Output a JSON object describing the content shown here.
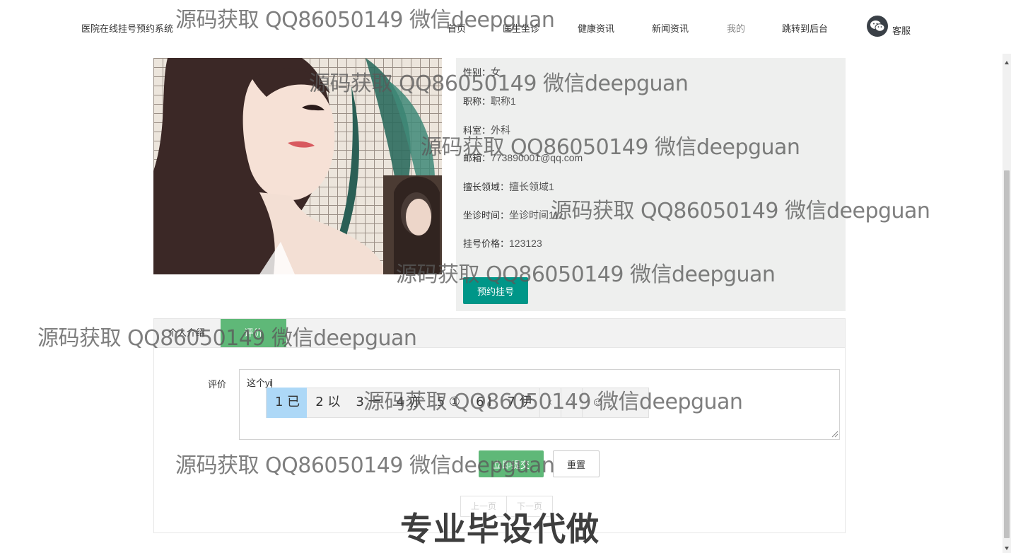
{
  "header": {
    "brand": "医院在线挂号预约系统",
    "nav": [
      {
        "label": "首页",
        "name": "nav-home"
      },
      {
        "label": "医生坐诊",
        "name": "nav-doctor-clinic"
      },
      {
        "label": "健康资讯",
        "name": "nav-health-news"
      },
      {
        "label": "新闻资讯",
        "name": "nav-news"
      },
      {
        "label": "我的",
        "name": "nav-mine"
      },
      {
        "label": "跳转到后台",
        "name": "nav-admin"
      }
    ],
    "service_label": "客服",
    "service_icon": "wechat-icon"
  },
  "doctor": {
    "fields": [
      {
        "label": "性别：",
        "value": "女"
      },
      {
        "label": "职称：",
        "value": "职称1"
      },
      {
        "label": "科室：",
        "value": "外科"
      },
      {
        "label": "邮箱：",
        "value": "773890001@qq.com"
      },
      {
        "label": "擅长领域：",
        "value": "擅长领域1"
      },
      {
        "label": "坐诊时间：",
        "value": "坐诊时间111"
      },
      {
        "label": "挂号价格：",
        "value": "123123"
      }
    ],
    "book_button": "预约挂号"
  },
  "tabs": [
    {
      "label": "个人介绍",
      "active": false
    },
    {
      "label": "评价",
      "active": true
    }
  ],
  "review_form": {
    "label": "评价",
    "value": "这个yi",
    "submit_label": "立即提交",
    "reset_label": "重置"
  },
  "pager": {
    "prev": "上一页",
    "next": "下一页"
  },
  "ime": {
    "candidates": [
      "1 已",
      "2 以",
      "3 一",
      "4 亦",
      "5 ①",
      "6 Ⅰ",
      "7 伊"
    ],
    "selected_index": 0,
    "prev_arrow": "‹",
    "next_arrow": "›",
    "emoji": "☺"
  },
  "watermarks": {
    "text": "源码获取 QQ86050149 微信deepguan",
    "banner": "专业毕设代做"
  },
  "colors": {
    "primary_teal": "#009688",
    "green": "#5fb878",
    "panel_gray": "#eeefee",
    "ime_selected": "#add8f7"
  }
}
